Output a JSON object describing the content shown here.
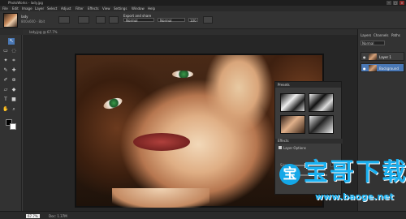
{
  "window": {
    "title": "PhotoWorks - lady.jpg"
  },
  "menu": [
    "File",
    "Edit",
    "Image",
    "Layer",
    "Select",
    "Adjust",
    "Filter",
    "Effects",
    "View",
    "Settings",
    "Window",
    "Help"
  ],
  "options": {
    "name": "lady",
    "size": "800x600 · 8bit",
    "label": "Export and share",
    "select1": "Normal",
    "select2": "Normal",
    "value": "100"
  },
  "document": {
    "tab": "lady.jpg @ 67.7%"
  },
  "right_panel": {
    "tabs": [
      "Layers",
      "Channels",
      "Paths"
    ],
    "blend": "Normal",
    "layers": [
      {
        "name": "Layer 1"
      },
      {
        "name": "Background"
      }
    ]
  },
  "float_panel": {
    "title": "Presets",
    "section": "Effects",
    "option": "Layer Options",
    "slider_labels": [
      "Size",
      "Blur"
    ],
    "value": "40"
  },
  "status": {
    "zoom": "67.7%",
    "info": "Doc: 1.37M"
  },
  "watermark": {
    "text": "宝哥下载",
    "icon": "宝",
    "url": "www.baoge.net"
  }
}
